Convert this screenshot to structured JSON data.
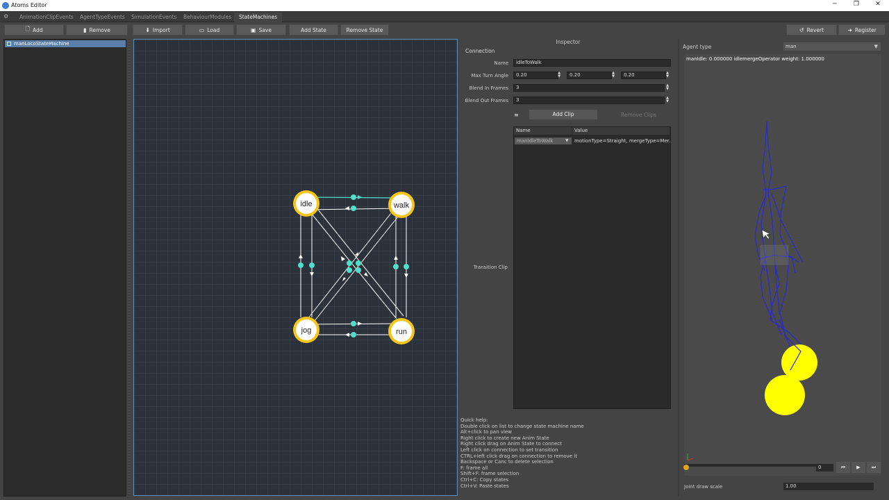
{
  "window": {
    "title": "Atoms Editor",
    "minimize": "─",
    "maximize": "❐",
    "close": "✕"
  },
  "tabs": [
    "AnimationClipEvents",
    "AgentTypeEvents",
    "SimulationEvents",
    "BehaviourModules",
    "StateMachines"
  ],
  "active_tab": "StateMachines",
  "toolbar": {
    "add": "Add",
    "remove": "Remove",
    "import": "Import",
    "load": "Load",
    "save": "Save",
    "add_state": "Add State",
    "remove_state": "Remove State",
    "revert": "Revert",
    "register": "Register"
  },
  "state_machines": {
    "items": [
      "manLocoStateMachine"
    ]
  },
  "graph": {
    "states": [
      "idle",
      "walk",
      "jog",
      "run"
    ],
    "node_color": "#f5c518",
    "edge_color": "#ffffff",
    "selected_edge_color": "#4fe0c8"
  },
  "inspector": {
    "title": "Inspector",
    "section": "Connection",
    "name_label": "Name",
    "name_value": "idleToWalk",
    "max_turn_label": "Max Turn Angle",
    "max_turn_values": [
      "0.20",
      "0.20",
      "0.20"
    ],
    "blend_in_label": "Blend In Frames",
    "blend_in_value": "3",
    "blend_out_label": "Blend Out Frames",
    "blend_out_value": "3",
    "add_clip": "Add Clip",
    "remove_clips": "Remove Clips",
    "transition_clip_label": "Transition Clip",
    "table": {
      "headers": [
        "Name",
        "Value"
      ],
      "rows": [
        [
          "manIdleToWalk",
          "motionType=Straight, mergeType=Mer..."
        ]
      ]
    }
  },
  "help": {
    "lines": [
      "Quick help:",
      "Double click on list to change state machine name",
      "Alt+click to pan view",
      "Right click to create new Anim State",
      "Right click drag on Anim State to connect",
      "Left click on connection to set transition",
      "CTRL+left click drag on connection to remove it",
      "Backspace or Canc to delete selection",
      "F: frame all",
      "Shift+F: frame selection",
      "Ctrl+C: Copy states",
      "Ctrl+V: Paste states"
    ]
  },
  "preview": {
    "agent_type_label": "Agent type",
    "agent_type_value": "man",
    "info": "manIdle: 0.000000  idlemergeOperator weight: 1.000000",
    "frame": "0",
    "joint_draw_scale_label": "Joint draw scale",
    "joint_draw_scale_value": "1.00",
    "skeleton_color": "#2a2ad0",
    "ball_color": "#ffff00"
  }
}
